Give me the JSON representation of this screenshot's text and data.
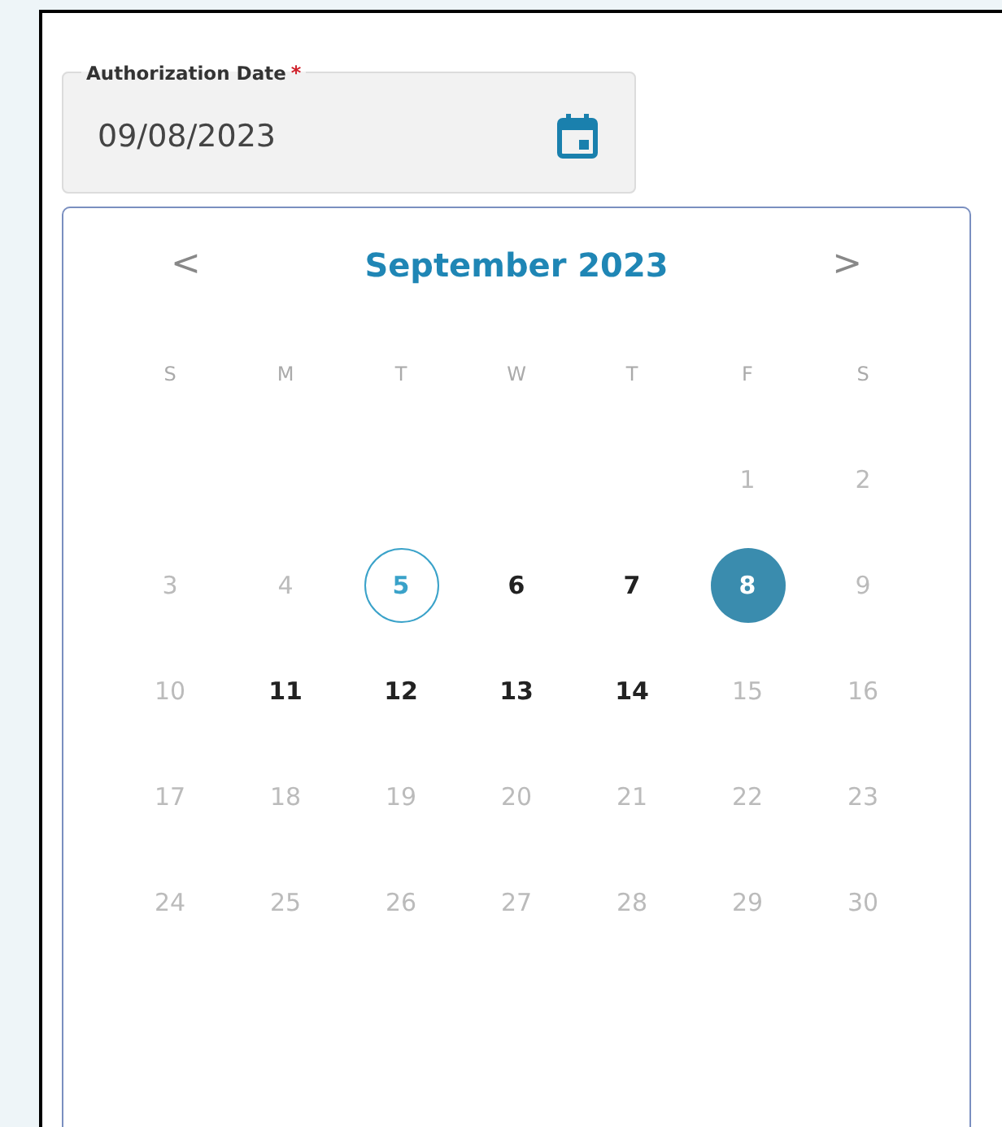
{
  "field": {
    "label": "Authorization Date",
    "required_mark": "*",
    "value": "09/08/2023"
  },
  "calendar": {
    "prev": "<",
    "title": "September 2023",
    "next": ">",
    "weekdays": [
      "S",
      "M",
      "T",
      "W",
      "T",
      "F",
      "S"
    ],
    "days": [
      {
        "kind": "blank"
      },
      {
        "kind": "blank"
      },
      {
        "kind": "blank"
      },
      {
        "kind": "blank"
      },
      {
        "kind": "blank"
      },
      {
        "kind": "day",
        "label": "1",
        "disabled": true,
        "today": false,
        "selected": false
      },
      {
        "kind": "day",
        "label": "2",
        "disabled": true,
        "today": false,
        "selected": false
      },
      {
        "kind": "day",
        "label": "3",
        "disabled": true,
        "today": false,
        "selected": false
      },
      {
        "kind": "day",
        "label": "4",
        "disabled": true,
        "today": false,
        "selected": false
      },
      {
        "kind": "day",
        "label": "5",
        "disabled": false,
        "today": true,
        "selected": false
      },
      {
        "kind": "day",
        "label": "6",
        "disabled": false,
        "today": false,
        "selected": false
      },
      {
        "kind": "day",
        "label": "7",
        "disabled": false,
        "today": false,
        "selected": false
      },
      {
        "kind": "day",
        "label": "8",
        "disabled": false,
        "today": false,
        "selected": true
      },
      {
        "kind": "day",
        "label": "9",
        "disabled": true,
        "today": false,
        "selected": false
      },
      {
        "kind": "day",
        "label": "10",
        "disabled": true,
        "today": false,
        "selected": false
      },
      {
        "kind": "day",
        "label": "11",
        "disabled": false,
        "today": false,
        "selected": false
      },
      {
        "kind": "day",
        "label": "12",
        "disabled": false,
        "today": false,
        "selected": false
      },
      {
        "kind": "day",
        "label": "13",
        "disabled": false,
        "today": false,
        "selected": false
      },
      {
        "kind": "day",
        "label": "14",
        "disabled": false,
        "today": false,
        "selected": false
      },
      {
        "kind": "day",
        "label": "15",
        "disabled": true,
        "today": false,
        "selected": false
      },
      {
        "kind": "day",
        "label": "16",
        "disabled": true,
        "today": false,
        "selected": false
      },
      {
        "kind": "day",
        "label": "17",
        "disabled": true,
        "today": false,
        "selected": false
      },
      {
        "kind": "day",
        "label": "18",
        "disabled": true,
        "today": false,
        "selected": false
      },
      {
        "kind": "day",
        "label": "19",
        "disabled": true,
        "today": false,
        "selected": false
      },
      {
        "kind": "day",
        "label": "20",
        "disabled": true,
        "today": false,
        "selected": false
      },
      {
        "kind": "day",
        "label": "21",
        "disabled": true,
        "today": false,
        "selected": false
      },
      {
        "kind": "day",
        "label": "22",
        "disabled": true,
        "today": false,
        "selected": false
      },
      {
        "kind": "day",
        "label": "23",
        "disabled": true,
        "today": false,
        "selected": false
      },
      {
        "kind": "day",
        "label": "24",
        "disabled": true,
        "today": false,
        "selected": false
      },
      {
        "kind": "day",
        "label": "25",
        "disabled": true,
        "today": false,
        "selected": false
      },
      {
        "kind": "day",
        "label": "26",
        "disabled": true,
        "today": false,
        "selected": false
      },
      {
        "kind": "day",
        "label": "27",
        "disabled": true,
        "today": false,
        "selected": false
      },
      {
        "kind": "day",
        "label": "28",
        "disabled": true,
        "today": false,
        "selected": false
      },
      {
        "kind": "day",
        "label": "29",
        "disabled": true,
        "today": false,
        "selected": false
      },
      {
        "kind": "day",
        "label": "30",
        "disabled": true,
        "today": false,
        "selected": false
      }
    ]
  }
}
